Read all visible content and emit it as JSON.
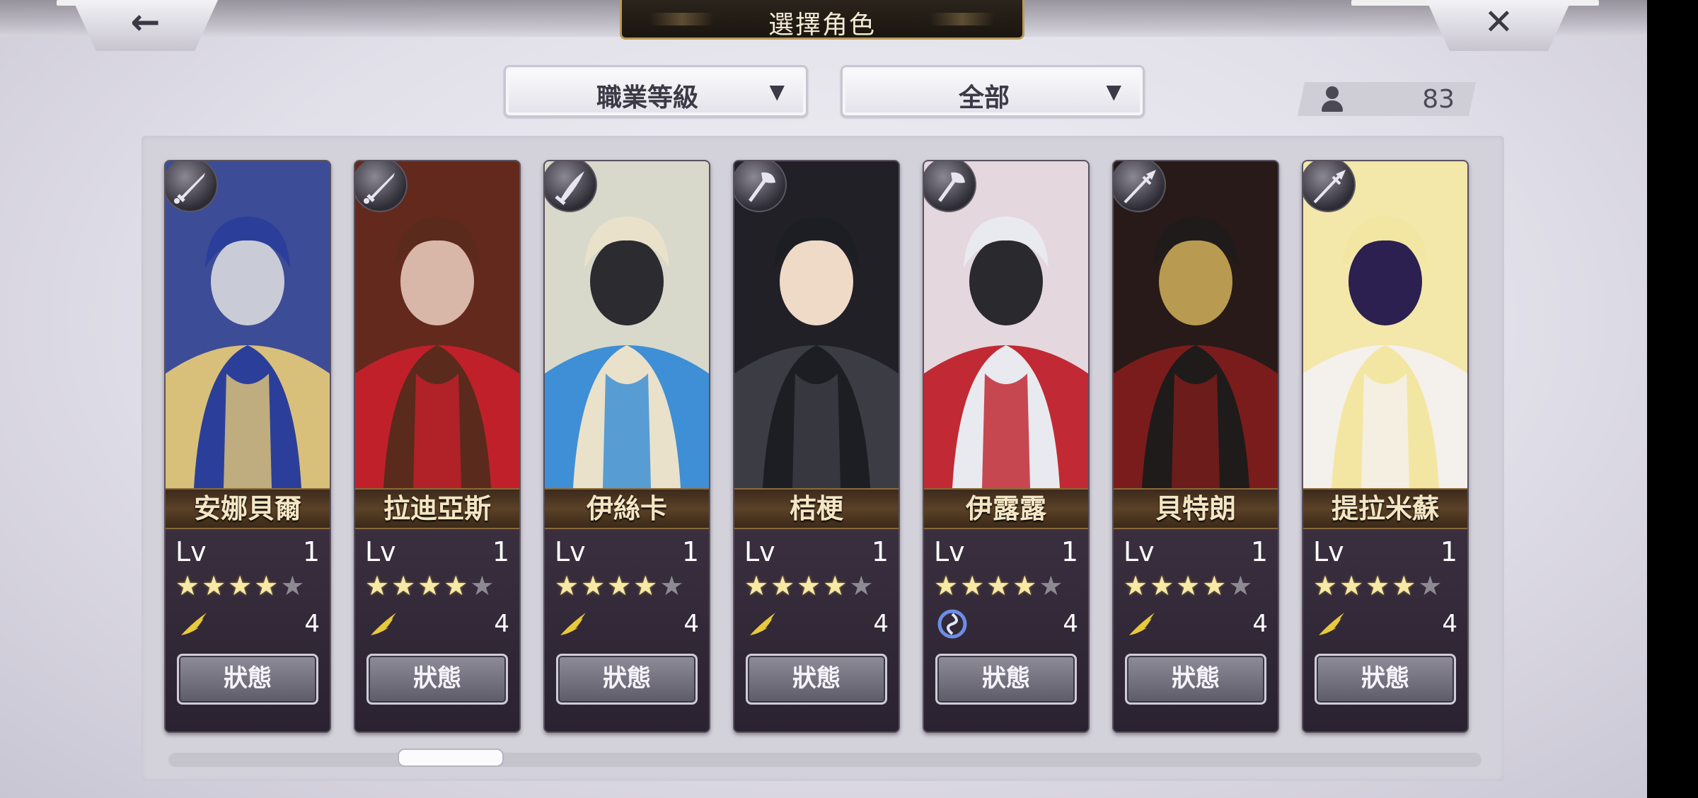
{
  "header": {
    "title": "選擇角色",
    "back_icon": "arrow-left-icon",
    "close_icon": "close-icon",
    "back_glyph": "←",
    "close_glyph": "✕"
  },
  "filters": {
    "sort_label": "職業等級",
    "category_label": "全部",
    "arrow_glyph": "▼"
  },
  "character_count": "83",
  "ui": {
    "lv_label": "Lv",
    "status_label": "狀態"
  },
  "characters": [
    {
      "name": "安娜貝爾",
      "level": "1",
      "stars": 4,
      "max_stars": 5,
      "element": "wind-icon",
      "element_value": "4",
      "class": "sword-icon",
      "palette": [
        "#2b3f9a",
        "#d9c07a",
        "#c9ccd6"
      ]
    },
    {
      "name": "拉迪亞斯",
      "level": "1",
      "stars": 4,
      "max_stars": 5,
      "element": "wind-icon",
      "element_value": "4",
      "class": "sword-icon",
      "palette": [
        "#5a2a1c",
        "#c0202a",
        "#d8b7a8"
      ]
    },
    {
      "name": "伊絲卡",
      "level": "1",
      "stars": 4,
      "max_stars": 5,
      "element": "wind-icon",
      "element_value": "4",
      "class": "blade-icon",
      "palette": [
        "#e9e1c9",
        "#3e8fd6",
        "#2b2b30"
      ]
    },
    {
      "name": "桔梗",
      "level": "1",
      "stars": 4,
      "max_stars": 5,
      "element": "wind-icon",
      "element_value": "4",
      "class": "axe-icon",
      "palette": [
        "#1d1d24",
        "#3c3c44",
        "#efd9c7"
      ]
    },
    {
      "name": "伊露露",
      "level": "1",
      "stars": 4,
      "max_stars": 5,
      "element": "water-icon",
      "element_value": "4",
      "class": "axe-icon",
      "palette": [
        "#e8eaf0",
        "#c12a34",
        "#2a2a2e"
      ]
    },
    {
      "name": "貝特朗",
      "level": "1",
      "stars": 4,
      "max_stars": 5,
      "element": "wind-icon",
      "element_value": "4",
      "class": "spear-icon",
      "palette": [
        "#1f1b1a",
        "#7a1c1c",
        "#b89a50"
      ]
    },
    {
      "name": "提拉米蘇",
      "level": "1",
      "stars": 4,
      "max_stars": 5,
      "element": "wind-icon",
      "element_value": "4",
      "class": "spear-icon",
      "palette": [
        "#f3e6a2",
        "#f4f0ec",
        "#2b2050"
      ]
    }
  ],
  "colors": {
    "star_on": "#f7e9a6",
    "star_off": "#8d8a94",
    "wind": "#e9c93c",
    "water": "#6d8ee6",
    "gold_rim": "#b89a58"
  },
  "scroll": {
    "position_fraction": 0.19
  }
}
